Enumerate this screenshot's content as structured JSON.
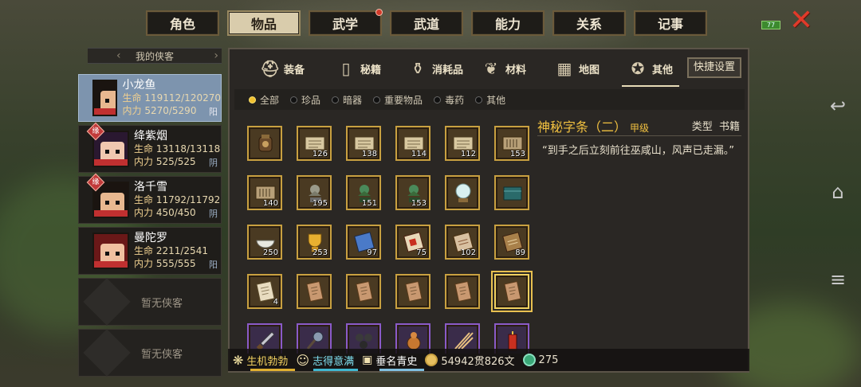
{
  "top_tabs": [
    {
      "label": "角色",
      "active": false,
      "badge": false
    },
    {
      "label": "物品",
      "active": true,
      "badge": false
    },
    {
      "label": "武学",
      "active": false,
      "badge": true
    },
    {
      "label": "武道",
      "active": false,
      "badge": false
    },
    {
      "label": "能力",
      "active": false,
      "badge": false
    },
    {
      "label": "关系",
      "active": false,
      "badge": false
    },
    {
      "label": "记事",
      "active": false,
      "badge": false
    }
  ],
  "battery": "77",
  "heroes": {
    "header": "我的侠客",
    "list": [
      {
        "name": "小龙鱼",
        "hp": "119112/120270",
        "mp": "5270/5290",
        "yinyang": "阳",
        "bond": false,
        "active": true
      },
      {
        "name": "绛紫烟",
        "hp": "13118/13118",
        "mp": "525/525",
        "yinyang": "阴",
        "bond": true,
        "active": false
      },
      {
        "name": "洛千雪",
        "hp": "11792/11792",
        "mp": "450/450",
        "yinyang": "阴",
        "bond": true,
        "active": false
      },
      {
        "name": "曼陀罗",
        "hp": "2211/2541",
        "mp": "555/555",
        "yinyang": "阳",
        "bond": false,
        "active": false
      }
    ],
    "hp_label": "生命",
    "mp_label": "内力",
    "bond_label": "缘",
    "empty_label": "暂无侠客"
  },
  "categories": [
    {
      "label": "装备",
      "icon": "equipment-icon"
    },
    {
      "label": "秘籍",
      "icon": "manual-icon"
    },
    {
      "label": "消耗品",
      "icon": "potion-icon"
    },
    {
      "label": "材料",
      "icon": "herb-icon"
    },
    {
      "label": "地图",
      "icon": "map-icon"
    },
    {
      "label": "其他",
      "icon": "lantern-icon",
      "active": true
    }
  ],
  "quick_settings": "快捷设置",
  "filters": [
    {
      "label": "全部",
      "on": true
    },
    {
      "label": "珍品",
      "on": false
    },
    {
      "label": "暗器",
      "on": false
    },
    {
      "label": "重要物品",
      "on": false
    },
    {
      "label": "毒药",
      "on": false
    },
    {
      "label": "其他",
      "on": false
    }
  ],
  "items": [
    {
      "kind": "jar",
      "count": ""
    },
    {
      "kind": "scroll",
      "count": "126"
    },
    {
      "kind": "scroll",
      "count": "138"
    },
    {
      "kind": "scroll",
      "count": "114"
    },
    {
      "kind": "scroll",
      "count": "112"
    },
    {
      "kind": "scroll-dark",
      "count": "153"
    },
    {
      "kind": "scroll-dark",
      "count": "140"
    },
    {
      "kind": "statue-gray",
      "count": "195"
    },
    {
      "kind": "statue-green",
      "count": "151"
    },
    {
      "kind": "statue-green",
      "count": "153"
    },
    {
      "kind": "pearl",
      "count": ""
    },
    {
      "kind": "box-teal",
      "count": ""
    },
    {
      "kind": "bowl",
      "count": "250"
    },
    {
      "kind": "trophy",
      "count": "253"
    },
    {
      "kind": "book-blue",
      "count": "97"
    },
    {
      "kind": "book-red",
      "count": "75"
    },
    {
      "kind": "book-tan",
      "count": "102"
    },
    {
      "kind": "book-brown",
      "count": "89"
    },
    {
      "kind": "paper",
      "count": "4"
    },
    {
      "kind": "note",
      "count": ""
    },
    {
      "kind": "note",
      "count": ""
    },
    {
      "kind": "note",
      "count": ""
    },
    {
      "kind": "note",
      "count": ""
    },
    {
      "kind": "note",
      "count": "",
      "selected": true
    },
    {
      "kind": "dagger",
      "count": "",
      "purple": true
    },
    {
      "kind": "mace",
      "count": "",
      "purple": true
    },
    {
      "kind": "beads",
      "count": "",
      "purple": true
    },
    {
      "kind": "gourd",
      "count": "",
      "purple": true
    },
    {
      "kind": "needles",
      "count": "",
      "purple": true
    },
    {
      "kind": "firecracker",
      "count": "",
      "purple": true
    }
  ],
  "detail": {
    "title": "神秘字条（二）",
    "grade": "甲级",
    "type_label": "类型",
    "type_value": "书籍",
    "description": "“到手之后立刻前往巫咸山，风声已走漏。”"
  },
  "status": {
    "s1": "生机勃勃",
    "s2": "志得意满",
    "s3": "垂名青史",
    "money": "54942贯826文",
    "jade": "275"
  }
}
